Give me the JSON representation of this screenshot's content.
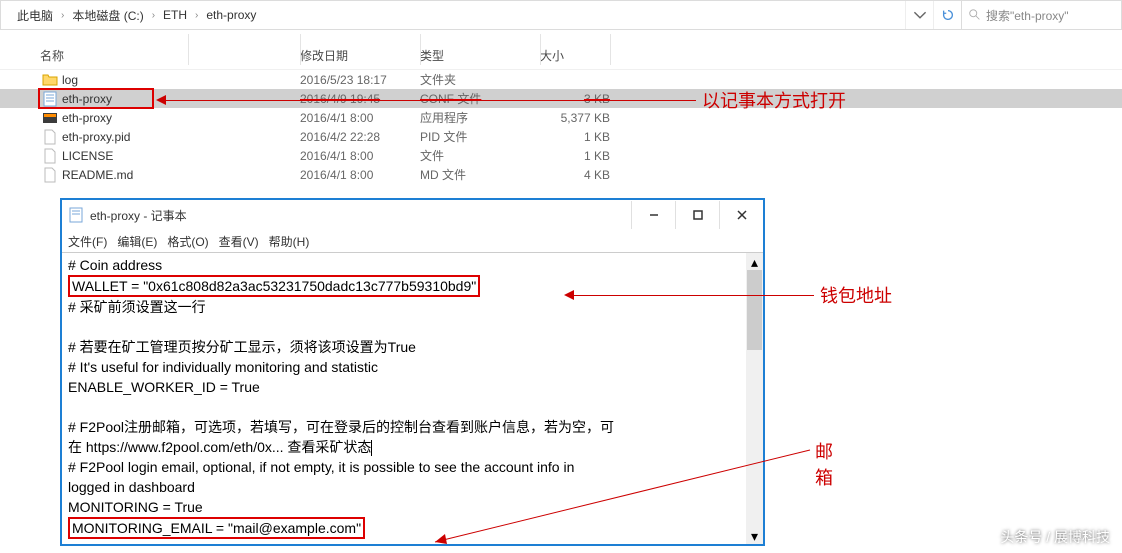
{
  "breadcrumb": {
    "items": [
      "此电脑",
      "本地磁盘 (C:)",
      "ETH",
      "eth-proxy"
    ],
    "refresh_title": "刷新",
    "dropdown_title": "历史"
  },
  "search": {
    "placeholder": "搜索\"eth-proxy\""
  },
  "columns": {
    "name": "名称",
    "date": "修改日期",
    "type": "类型",
    "size": "大小"
  },
  "files": [
    {
      "name": "log",
      "date": "2016/5/23 18:17",
      "type": "文件夹",
      "size": "",
      "icon": "folder"
    },
    {
      "name": "eth-proxy",
      "date": "2016/4/9 19:45",
      "type": "CONF 文件",
      "size": "3 KB",
      "icon": "text",
      "selected": true,
      "strike": true
    },
    {
      "name": "eth-proxy",
      "date": "2016/4/1 8:00",
      "type": "应用程序",
      "size": "5,377 KB",
      "icon": "exe"
    },
    {
      "name": "eth-proxy.pid",
      "date": "2016/4/2 22:28",
      "type": "PID 文件",
      "size": "1 KB",
      "icon": "file"
    },
    {
      "name": "LICENSE",
      "date": "2016/4/1 8:00",
      "type": "文件",
      "size": "1 KB",
      "icon": "file"
    },
    {
      "name": "README.md",
      "date": "2016/4/1 8:00",
      "type": "MD 文件",
      "size": "4 KB",
      "icon": "file"
    }
  ],
  "annotations": {
    "open_with_notepad": "以记事本方式打开",
    "wallet_address": "钱包地址",
    "email": "邮箱"
  },
  "notepad": {
    "title": "eth-proxy - 记事本",
    "menu": {
      "file": "文件(F)",
      "edit": "编辑(E)",
      "format": "格式(O)",
      "view": "查看(V)",
      "help": "帮助(H)"
    },
    "lines": {
      "l1": "# Coin address",
      "l2": "WALLET = \"0x61c808d82a3ac53231750dadc13c777b59310bd9\"",
      "l3": "# 采矿前须设置这一行",
      "l4": "",
      "l5": "# 若要在矿工管理页按分矿工显示，须将该项设置为True",
      "l6": "# It's useful for individually monitoring and statistic",
      "l7": "ENABLE_WORKER_ID = True",
      "l8": "",
      "l9": "# F2Pool注册邮箱，可选项，若填写，可在登录后的控制台查看到账户信息，若为空，可",
      "l10": "在 https://www.f2pool.com/eth/0x... 查看采矿状态",
      "l11": "# F2Pool login email, optional, if not empty, it is possible to see the account info in",
      "l12": "logged in dashboard",
      "l13": "MONITORING = True",
      "l14": "MONITORING_EMAIL = \"mail@example.com\""
    }
  },
  "watermark": "头条号 / 展博科技"
}
